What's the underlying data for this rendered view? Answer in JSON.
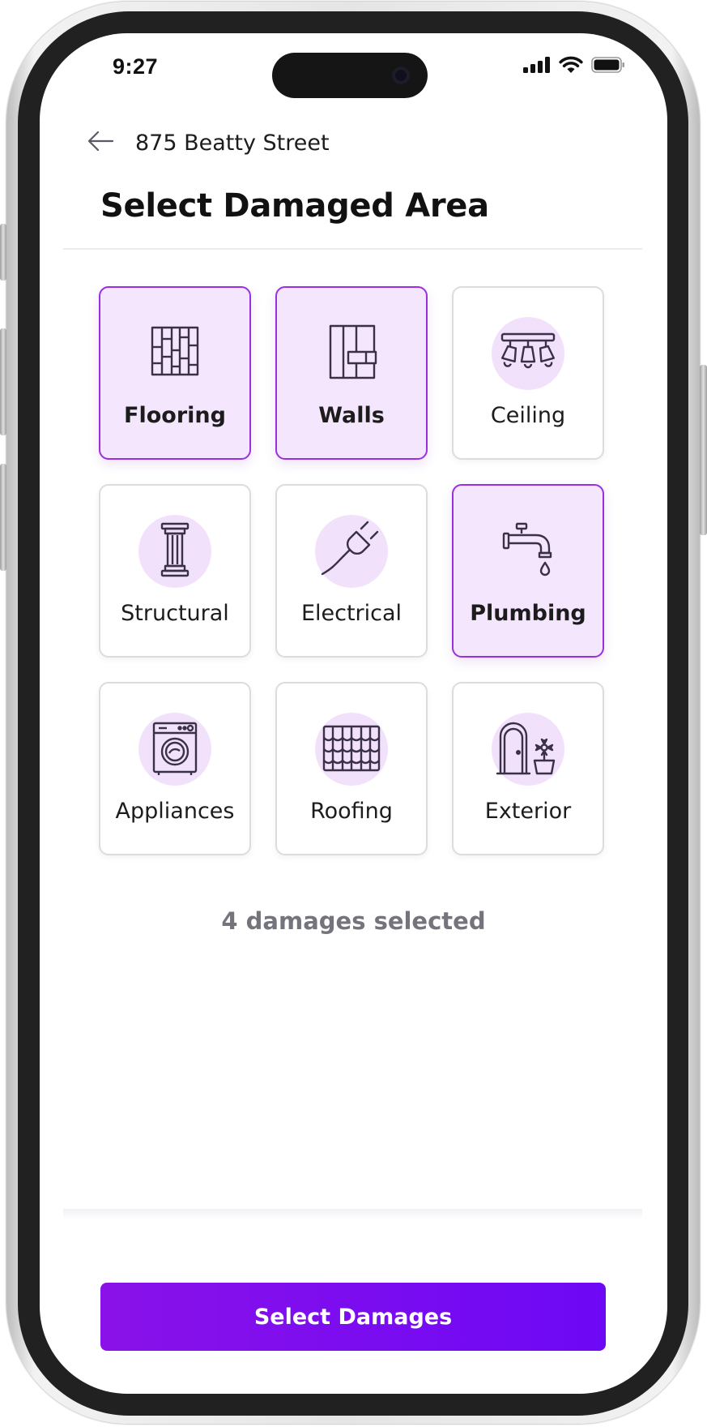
{
  "status_bar": {
    "time": "9:27",
    "icons": [
      "cellular-signal-icon",
      "wifi-icon",
      "battery-icon"
    ]
  },
  "header": {
    "back_icon": "arrow-left-icon",
    "address": "875 Beatty Street",
    "title": "Select Damaged Area"
  },
  "categories": [
    {
      "label": "Flooring",
      "icon": "flooring-icon",
      "selected": true
    },
    {
      "label": "Walls",
      "icon": "wall-panel-icon",
      "selected": true
    },
    {
      "label": "Ceiling",
      "icon": "ceiling-light-icon",
      "selected": false
    },
    {
      "label": "Structural",
      "icon": "pillar-icon",
      "selected": false
    },
    {
      "label": "Electrical",
      "icon": "plug-icon",
      "selected": false
    },
    {
      "label": "Plumbing",
      "icon": "faucet-icon",
      "selected": true
    },
    {
      "label": "Appliances",
      "icon": "washing-machine-icon",
      "selected": false
    },
    {
      "label": "Roofing",
      "icon": "roof-tiles-icon",
      "selected": false
    },
    {
      "label": "Exterior",
      "icon": "door-plant-icon",
      "selected": false
    }
  ],
  "selection_summary": "4 damages selected",
  "cta_label": "Select Damages",
  "colors": {
    "accent": "#7a0cf0",
    "selected_bg": "#f4e6fd",
    "selected_border": "#9b2fe0",
    "icon_circle": "#f1e1fb",
    "summary_text": "#74747c"
  }
}
